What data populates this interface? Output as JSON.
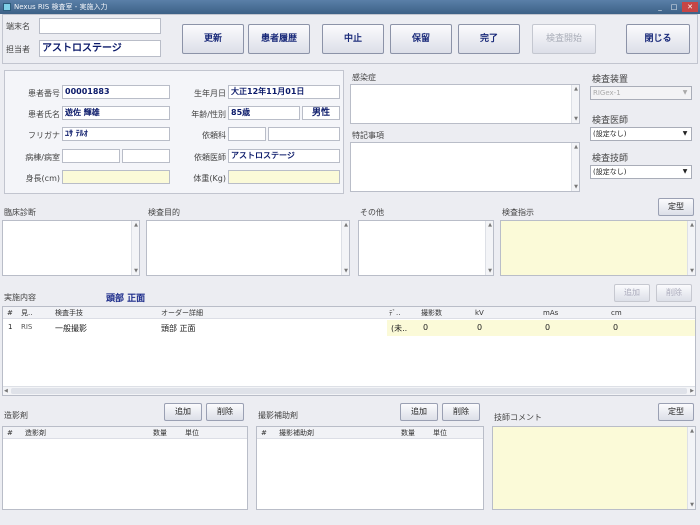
{
  "window": {
    "title": "Nexus RIS 検査室 - 実施入力"
  },
  "toolbar": {
    "terminal_label": "端末名",
    "terminal_value": "",
    "operator_label": "担当者",
    "operator_value": "アストロステージ",
    "buttons": [
      "更新",
      "患者履歴",
      "中止",
      "保留",
      "完了",
      "検査開始",
      "閉じる"
    ]
  },
  "patient": {
    "id_label": "患者番号",
    "id_value": "00001883",
    "birth_label": "生年月日",
    "birth_value": "大正12年11月01日",
    "name_label": "患者氏名",
    "name_value": "遊佐 輝雄",
    "age_sex_label": "年齢/性別",
    "age_value": "85歳",
    "sex_value": "男性",
    "kana_label": "フリガナ",
    "kana_value": "ﾕｻ ﾃﾙｵ",
    "dept_label": "依頼科",
    "ward_label": "病棟/病室",
    "doctor_label": "依頼医師",
    "doctor_value": "アストロステージ",
    "height_label": "身長(cm)",
    "weight_label": "体重(Kg)"
  },
  "notes": {
    "infection_label": "感染症",
    "special_label": "特記事項"
  },
  "exam_side": {
    "device_label": "検査装置",
    "device_value": "RIGex-1",
    "doctor_label": "検査医師",
    "doctor_value": "(設定なし)",
    "tech_label": "検査技師",
    "tech_value": "(設定なし)"
  },
  "sections": {
    "clinical_label": "臨床診断",
    "purpose_label": "検査目的",
    "other_label": "その他",
    "instruction_label": "検査指示",
    "template_label": "定型"
  },
  "performed": {
    "label": "実施内容",
    "value": "頭部 正面",
    "add_label": "追加",
    "delete_label": "削除",
    "headers": [
      "#",
      "見..",
      "検査手技",
      "オーダー詳細",
      "ﾃﾞ..",
      "撮影数",
      "kV",
      "mAs",
      "cm"
    ],
    "rows": [
      [
        "1",
        "RIS",
        "一般撮影",
        "頭部 正面",
        "(未..",
        "0",
        "0",
        "0",
        "0"
      ]
    ]
  },
  "contrast": {
    "label": "造影剤",
    "add_label": "追加",
    "delete_label": "削除",
    "headers": [
      "#",
      "造影剤",
      "数量",
      "単位"
    ]
  },
  "aux": {
    "label": "撮影補助剤",
    "add_label": "追加",
    "delete_label": "削除",
    "headers": [
      "#",
      "撮影補助剤",
      "数量",
      "単位"
    ]
  },
  "tech_comment": {
    "label": "技師コメント",
    "template_label": "定型"
  }
}
